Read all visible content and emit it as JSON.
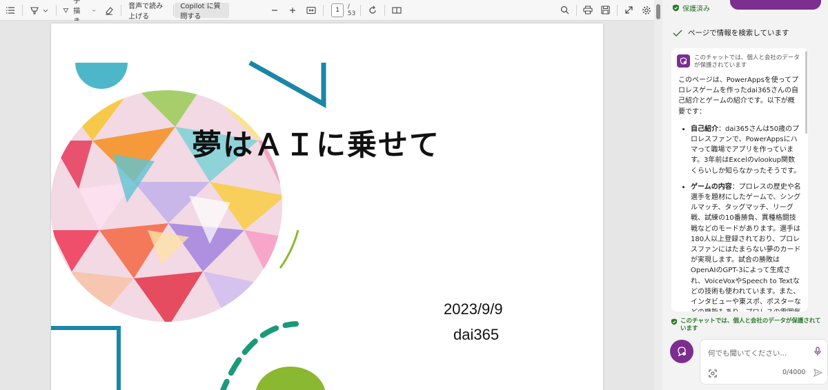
{
  "toolbar": {
    "draw_label": "手描き",
    "read_aloud_label": "音声で読み上げる",
    "copilot_label": "Copilot に質問する",
    "page_current": "1",
    "page_total": "/ 53"
  },
  "slide": {
    "title": "夢はＡＩに乗せて",
    "date": "2023/9/9",
    "author": "dai365"
  },
  "copilot": {
    "protected_top": "保護済み",
    "search_status": "ページで情報を検索しています",
    "card_note": "このチャットでは、個人と会社のデータが保護されています",
    "intro": "このページは、PowerAppsを使ってプロレスゲームを作ったdai365さんの自己紹介とゲームの紹介です。以下が概要です：",
    "items": [
      {
        "title": "自己紹介",
        "text": "：dai365さんは50歳のプロレスファンで、PowerAppsにハマって職場でアプリを作っています。3年前はExcelのvlookup関数くらいしか知らなかったそうです。"
      },
      {
        "title": "ゲームの内容",
        "text": "：プロレスの歴史や名選手を題材にしたゲームで、シングルマッチ、タッグマッチ、リーグ戦、試練の10番勝負、異種格闘技戦などのモードがあります。選手は180人以上登録されており、プロレスファンにはたまらない夢のカードが実現します。試合の勝敗はOpenAIのGPT-3によって生成され、VoiceVoxやSpeech to Textなどの技術も使われています。また、インタビューや東スポ、ポスターなどの機能もあり、プロレスの雰囲気を楽しめます。"
      }
    ],
    "protected_bottom": "このチャットでは、個人と会社のデータが保護されています",
    "input_placeholder": "何でも聞いてください...",
    "char_count": "0/4000"
  },
  "colors": {
    "copilot_purple": "#7c2d8f",
    "protected_green": "#2b7a2b",
    "slide_teal": "#1a86a8",
    "slide_green": "#8ab830",
    "slide_sky": "#4db6c9"
  }
}
